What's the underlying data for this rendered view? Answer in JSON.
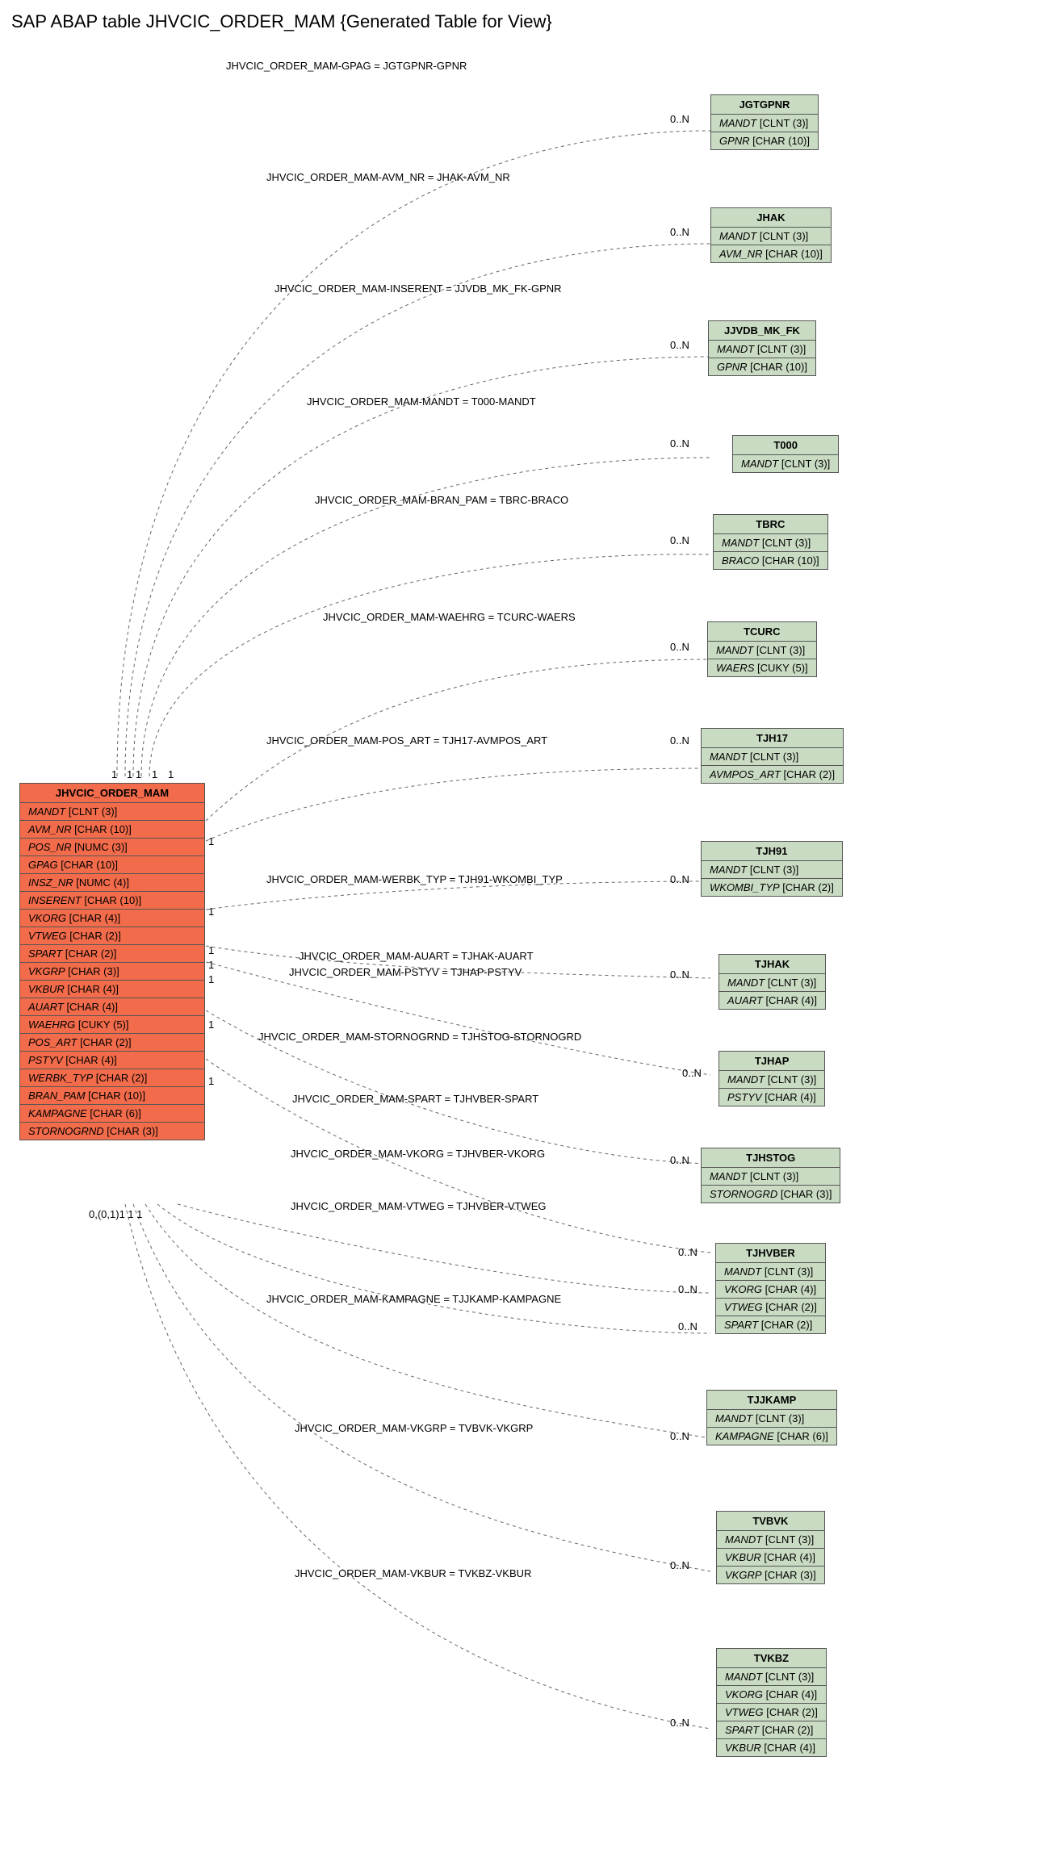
{
  "title": "SAP ABAP table JHVCIC_ORDER_MAM {Generated Table for View}",
  "main_entity": {
    "name": "JHVCIC_ORDER_MAM",
    "fields": [
      {
        "fname": "MANDT",
        "ftype": "[CLNT (3)]"
      },
      {
        "fname": "AVM_NR",
        "ftype": "[CHAR (10)]"
      },
      {
        "fname": "POS_NR",
        "ftype": "[NUMC (3)]"
      },
      {
        "fname": "GPAG",
        "ftype": "[CHAR (10)]"
      },
      {
        "fname": "INSZ_NR",
        "ftype": "[NUMC (4)]"
      },
      {
        "fname": "INSERENT",
        "ftype": "[CHAR (10)]"
      },
      {
        "fname": "VKORG",
        "ftype": "[CHAR (4)]"
      },
      {
        "fname": "VTWEG",
        "ftype": "[CHAR (2)]"
      },
      {
        "fname": "SPART",
        "ftype": "[CHAR (2)]"
      },
      {
        "fname": "VKGRP",
        "ftype": "[CHAR (3)]"
      },
      {
        "fname": "VKBUR",
        "ftype": "[CHAR (4)]"
      },
      {
        "fname": "AUART",
        "ftype": "[CHAR (4)]"
      },
      {
        "fname": "WAEHRG",
        "ftype": "[CUKY (5)]"
      },
      {
        "fname": "POS_ART",
        "ftype": "[CHAR (2)]"
      },
      {
        "fname": "PSTYV",
        "ftype": "[CHAR (4)]"
      },
      {
        "fname": "WERBK_TYP",
        "ftype": "[CHAR (2)]"
      },
      {
        "fname": "BRAN_PAM",
        "ftype": "[CHAR (10)]"
      },
      {
        "fname": "KAMPAGNE",
        "ftype": "[CHAR (6)]"
      },
      {
        "fname": "STORNOGRND",
        "ftype": "[CHAR (3)]"
      }
    ]
  },
  "right_entities": [
    {
      "name": "JGTGPNR",
      "fields": [
        {
          "fname": "MANDT",
          "ftype": "[CLNT (3)]"
        },
        {
          "fname": "GPNR",
          "ftype": "[CHAR (10)]"
        }
      ]
    },
    {
      "name": "JHAK",
      "fields": [
        {
          "fname": "MANDT",
          "ftype": "[CLNT (3)]"
        },
        {
          "fname": "AVM_NR",
          "ftype": "[CHAR (10)]"
        }
      ]
    },
    {
      "name": "JJVDB_MK_FK",
      "fields": [
        {
          "fname": "MANDT",
          "ftype": "[CLNT (3)]"
        },
        {
          "fname": "GPNR",
          "ftype": "[CHAR (10)]"
        }
      ]
    },
    {
      "name": "T000",
      "fields": [
        {
          "fname": "MANDT",
          "ftype": "[CLNT (3)]"
        }
      ]
    },
    {
      "name": "TBRC",
      "fields": [
        {
          "fname": "MANDT",
          "ftype": "[CLNT (3)]"
        },
        {
          "fname": "BRACO",
          "ftype": "[CHAR (10)]"
        }
      ]
    },
    {
      "name": "TCURC",
      "fields": [
        {
          "fname": "MANDT",
          "ftype": "[CLNT (3)]"
        },
        {
          "fname": "WAERS",
          "ftype": "[CUKY (5)]"
        }
      ]
    },
    {
      "name": "TJH17",
      "fields": [
        {
          "fname": "MANDT",
          "ftype": "[CLNT (3)]"
        },
        {
          "fname": "AVMPOS_ART",
          "ftype": "[CHAR (2)]"
        }
      ]
    },
    {
      "name": "TJH91",
      "fields": [
        {
          "fname": "MANDT",
          "ftype": "[CLNT (3)]"
        },
        {
          "fname": "WKOMBI_TYP",
          "ftype": "[CHAR (2)]"
        }
      ]
    },
    {
      "name": "TJHAK",
      "fields": [
        {
          "fname": "MANDT",
          "ftype": "[CLNT (3)]"
        },
        {
          "fname": "AUART",
          "ftype": "[CHAR (4)]"
        }
      ]
    },
    {
      "name": "TJHAP",
      "fields": [
        {
          "fname": "MANDT",
          "ftype": "[CLNT (3)]"
        },
        {
          "fname": "PSTYV",
          "ftype": "[CHAR (4)]"
        }
      ]
    },
    {
      "name": "TJHSTOG",
      "fields": [
        {
          "fname": "MANDT",
          "ftype": "[CLNT (3)]"
        },
        {
          "fname": "STORNOGRD",
          "ftype": "[CHAR (3)]"
        }
      ]
    },
    {
      "name": "TJHVBER",
      "fields": [
        {
          "fname": "MANDT",
          "ftype": "[CLNT (3)]"
        },
        {
          "fname": "VKORG",
          "ftype": "[CHAR (4)]"
        },
        {
          "fname": "VTWEG",
          "ftype": "[CHAR (2)]"
        },
        {
          "fname": "SPART",
          "ftype": "[CHAR (2)]"
        }
      ]
    },
    {
      "name": "TJJKAMP",
      "fields": [
        {
          "fname": "MANDT",
          "ftype": "[CLNT (3)]"
        },
        {
          "fname": "KAMPAGNE",
          "ftype": "[CHAR (6)]"
        }
      ]
    },
    {
      "name": "TVBVK",
      "fields": [
        {
          "fname": "MANDT",
          "ftype": "[CLNT (3)]"
        },
        {
          "fname": "VKBUR",
          "ftype": "[CHAR (4)]"
        },
        {
          "fname": "VKGRP",
          "ftype": "[CHAR (3)]"
        }
      ]
    },
    {
      "name": "TVKBZ",
      "fields": [
        {
          "fname": "MANDT",
          "ftype": "[CLNT (3)]"
        },
        {
          "fname": "VKORG",
          "ftype": "[CHAR (4)]"
        },
        {
          "fname": "VTWEG",
          "ftype": "[CHAR (2)]"
        },
        {
          "fname": "SPART",
          "ftype": "[CHAR (2)]"
        },
        {
          "fname": "VKBUR",
          "ftype": "[CHAR (4)]"
        }
      ]
    }
  ],
  "edges": [
    {
      "label": "JHVCIC_ORDER_MAM-GPAG = JGTGPNR-GPNR",
      "right_card": "0..N"
    },
    {
      "label": "JHVCIC_ORDER_MAM-AVM_NR = JHAK-AVM_NR",
      "right_card": "0..N"
    },
    {
      "label": "JHVCIC_ORDER_MAM-INSERENT = JJVDB_MK_FK-GPNR",
      "right_card": "0..N"
    },
    {
      "label": "JHVCIC_ORDER_MAM-MANDT = T000-MANDT",
      "right_card": "0..N"
    },
    {
      "label": "JHVCIC_ORDER_MAM-BRAN_PAM = TBRC-BRACO",
      "right_card": "0..N"
    },
    {
      "label": "JHVCIC_ORDER_MAM-WAEHRG = TCURC-WAERS",
      "right_card": "0..N"
    },
    {
      "label": "JHVCIC_ORDER_MAM-POS_ART = TJH17-AVMPOS_ART",
      "right_card": "0..N"
    },
    {
      "label": "JHVCIC_ORDER_MAM-WERBK_TYP = TJH91-WKOMBI_TYP",
      "right_card": "0..N"
    },
    {
      "label": "JHVCIC_ORDER_MAM-AUART = TJHAK-AUART",
      "right_card": "0..N"
    },
    {
      "label": "JHVCIC_ORDER_MAM-PSTYV = TJHAP-PSTYV",
      "right_card": ""
    },
    {
      "label": "JHVCIC_ORDER_MAM-STORNOGRND = TJHSTOG-STORNOGRD",
      "right_card": "0..N"
    },
    {
      "label": "JHVCIC_ORDER_MAM-SPART = TJHVBER-SPART",
      "right_card": "0..N"
    },
    {
      "label": "JHVCIC_ORDER_MAM-VKORG = TJHVBER-VKORG",
      "right_card": "0..N"
    },
    {
      "label": "JHVCIC_ORDER_MAM-VTWEG = TJHVBER-VTWEG",
      "right_card": "0..N"
    },
    {
      "label": "JHVCIC_ORDER_MAM-KAMPAGNE = TJJKAMP-KAMPAGNE",
      "right_card": "0..N"
    },
    {
      "label": "JHVCIC_ORDER_MAM-VKGRP = TVBVK-VKGRP",
      "right_card": "0..N"
    },
    {
      "label": "JHVCIC_ORDER_MAM-VKBUR = TVKBZ-VKBUR",
      "right_card": "0..N"
    }
  ],
  "left_top_cards": [
    "1",
    "1",
    "1",
    "1",
    "1"
  ],
  "left_mid_cards": [
    "1",
    "1",
    "1",
    "1",
    "1",
    "1",
    "1"
  ],
  "left_bot_cards_text": "0,(0,1)1  1  1",
  "tjhap_card": "0..N",
  "tjhvber_cards": [
    "0..N",
    "0..N",
    "0..N"
  ]
}
